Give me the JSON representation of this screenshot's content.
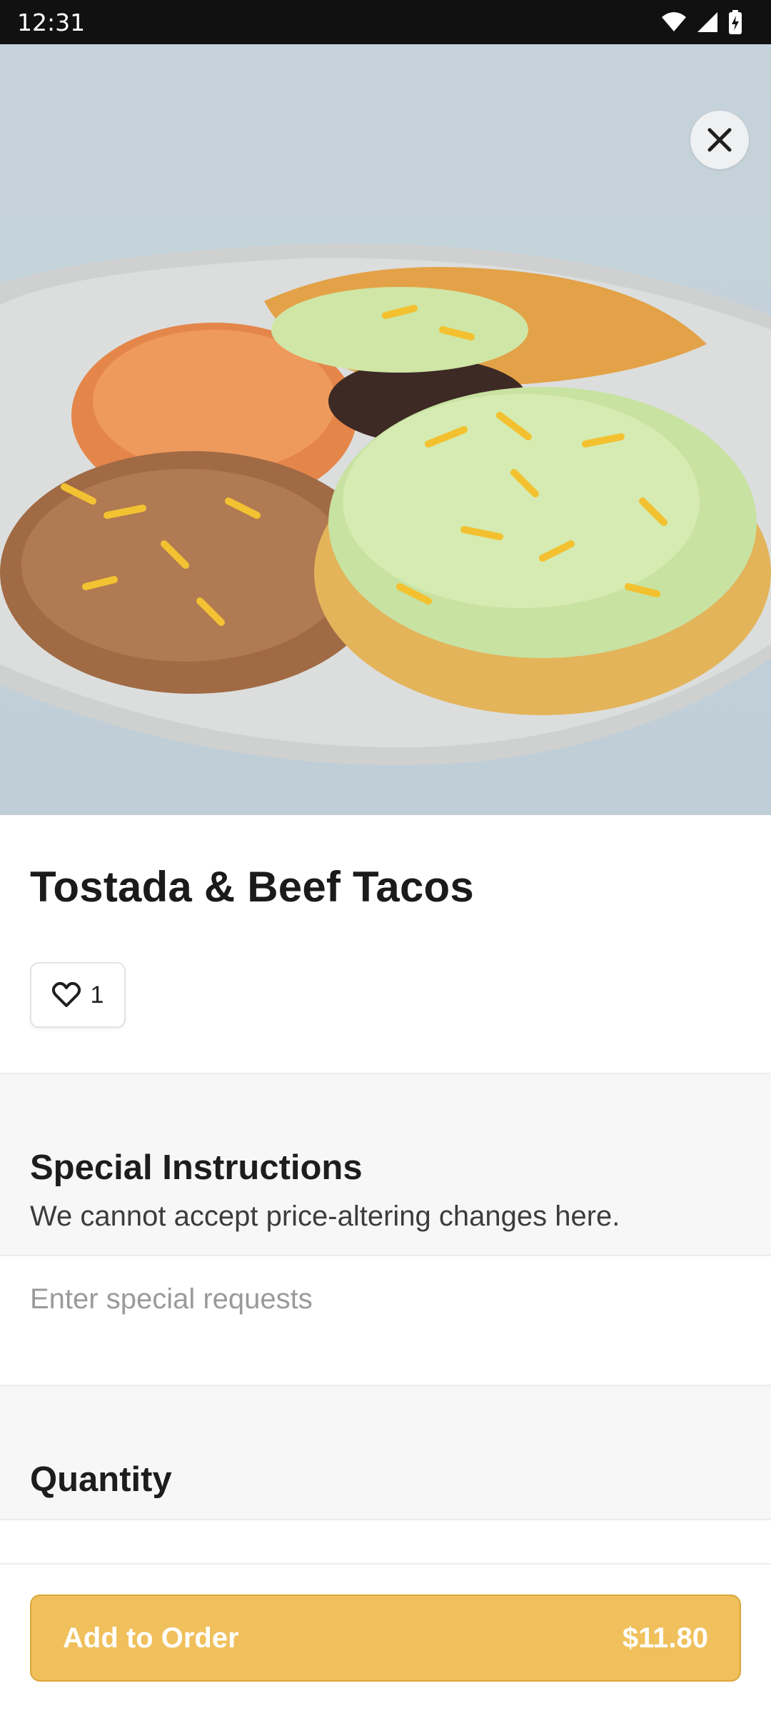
{
  "status_bar": {
    "time": "12:31"
  },
  "item": {
    "title": "Tostada & Beef Tacos",
    "like_count": "1"
  },
  "special_instructions": {
    "title": "Special Instructions",
    "subtitle": "We cannot accept price-altering changes here.",
    "placeholder": "Enter special requests",
    "value": ""
  },
  "quantity": {
    "title": "Quantity"
  },
  "footer": {
    "add_label": "Add to Order",
    "price": "$11.80"
  },
  "colors": {
    "accent": "#f0c05c",
    "accent_border": "#dca63a",
    "status_bar": "#111111"
  },
  "icons": [
    "wifi-icon",
    "signal-icon",
    "battery-icon",
    "close-icon",
    "heart-icon"
  ]
}
